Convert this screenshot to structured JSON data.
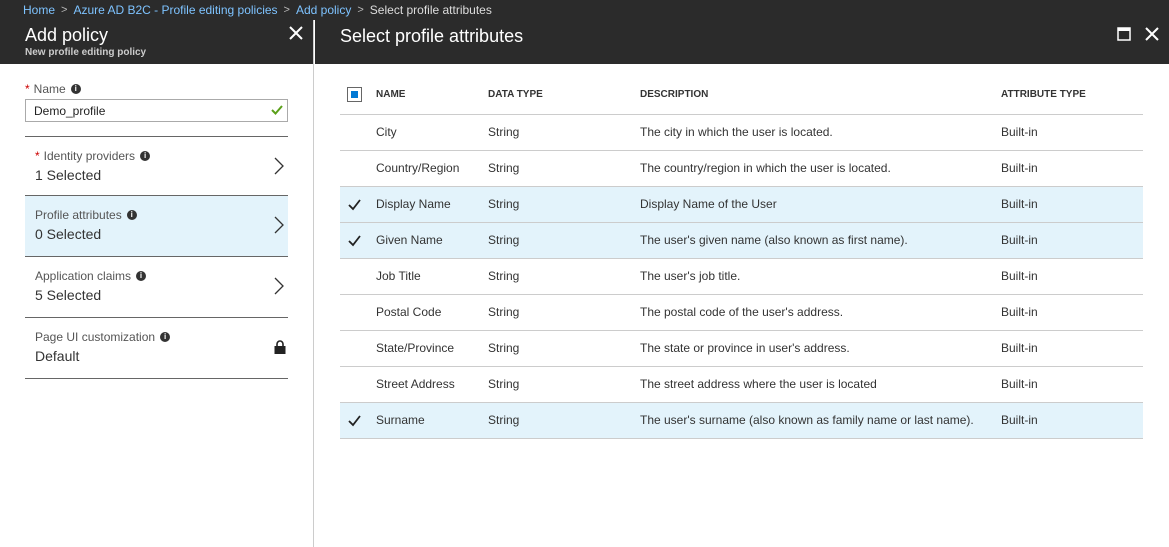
{
  "breadcrumb": {
    "items": [
      "Home",
      "Azure AD B2C - Profile editing policies",
      "Add policy"
    ],
    "current": "Select profile attributes"
  },
  "left": {
    "title": "Add policy",
    "subtitle": "New profile editing policy",
    "name_label": "Name",
    "name_value": "Demo_profile",
    "nav": [
      {
        "label": "Identity providers",
        "value": "1 Selected",
        "required": true
      },
      {
        "label": "Profile attributes",
        "value": "0 Selected",
        "required": false
      },
      {
        "label": "Application claims",
        "value": "5 Selected",
        "required": false
      },
      {
        "label": "Page UI customization",
        "value": "Default",
        "required": false
      }
    ]
  },
  "right": {
    "title": "Select profile attributes",
    "headers": {
      "name": "NAME",
      "type": "DATA TYPE",
      "desc": "DESCRIPTION",
      "attr": "ATTRIBUTE TYPE"
    },
    "rows": [
      {
        "name": "City",
        "type": "String",
        "desc": "The city in which the user is located.",
        "attr": "Built-in",
        "checked": false
      },
      {
        "name": "Country/Region",
        "type": "String",
        "desc": "The country/region in which the user is located.",
        "attr": "Built-in",
        "checked": false
      },
      {
        "name": "Display Name",
        "type": "String",
        "desc": "Display Name of the User",
        "attr": "Built-in",
        "checked": true
      },
      {
        "name": "Given Name",
        "type": "String",
        "desc": "The user's given name (also known as first name).",
        "attr": "Built-in",
        "checked": true
      },
      {
        "name": "Job Title",
        "type": "String",
        "desc": "The user's job title.",
        "attr": "Built-in",
        "checked": false
      },
      {
        "name": "Postal Code",
        "type": "String",
        "desc": "The postal code of the user's address.",
        "attr": "Built-in",
        "checked": false
      },
      {
        "name": "State/Province",
        "type": "String",
        "desc": "The state or province in user's address.",
        "attr": "Built-in",
        "checked": false
      },
      {
        "name": "Street Address",
        "type": "String",
        "desc": "The street address where the user is located",
        "attr": "Built-in",
        "checked": false
      },
      {
        "name": "Surname",
        "type": "String",
        "desc": "The user's surname (also known as family name or last name).",
        "attr": "Built-in",
        "checked": true
      }
    ]
  },
  "icons": {
    "info": "i"
  }
}
